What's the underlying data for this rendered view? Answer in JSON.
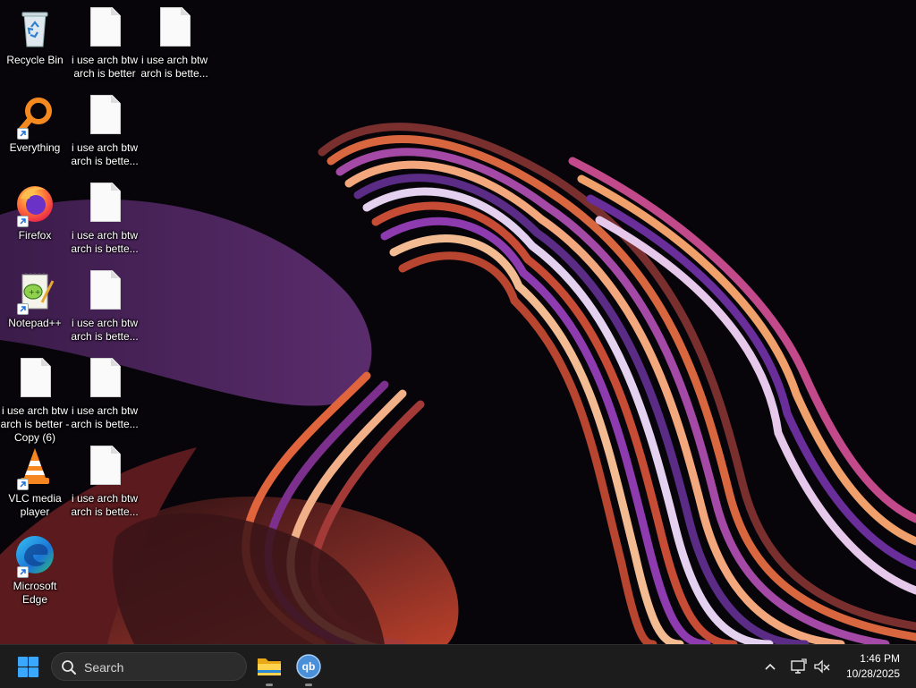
{
  "desktop": {
    "icons": [
      {
        "label": "Recycle Bin",
        "icon": "recycle-bin-icon",
        "shortcut": false
      },
      {
        "label": "i use arch btw arch is better",
        "icon": "text-document-icon",
        "shortcut": false
      },
      {
        "label": "i use arch btw arch is bette...",
        "icon": "text-document-icon",
        "shortcut": false
      },
      {
        "label": "Everything",
        "icon": "everything-search-icon",
        "shortcut": true
      },
      {
        "label": "i use arch btw arch is bette...",
        "icon": "text-document-icon",
        "shortcut": false
      },
      {
        "label": "Firefox",
        "icon": "firefox-icon",
        "shortcut": true
      },
      {
        "label": "i use arch btw arch is bette...",
        "icon": "text-document-icon",
        "shortcut": false
      },
      {
        "label": "Notepad++",
        "icon": "notepad-plus-plus-icon",
        "shortcut": true
      },
      {
        "label": "i use arch btw arch is bette...",
        "icon": "text-document-icon",
        "shortcut": false
      },
      {
        "label": "i use arch btw arch is better - Copy (6)",
        "icon": "text-document-icon",
        "shortcut": false
      },
      {
        "label": "i use arch btw arch is bette...",
        "icon": "text-document-icon",
        "shortcut": false
      },
      {
        "label": "VLC media player",
        "icon": "vlc-icon",
        "shortcut": true
      },
      {
        "label": "i use arch btw arch is bette...",
        "icon": "text-document-icon",
        "shortcut": false
      },
      {
        "label": "Microsoft Edge",
        "icon": "edge-icon",
        "shortcut": true
      }
    ]
  },
  "taskbar": {
    "start_icon": "windows-start-icon",
    "search_placeholder": "Search",
    "pinned_apps": [
      {
        "name": "File Explorer",
        "icon": "file-explorer-icon"
      },
      {
        "name": "qBittorrent",
        "icon": "qbittorrent-icon",
        "glyph": "qb"
      }
    ],
    "tray_icons": [
      "chevron-up-icon",
      "network-icon",
      "volume-muted-icon"
    ],
    "time": "1:46 PM",
    "date": "10/28/2025"
  },
  "colors": {
    "accent": "#3aa8ff",
    "taskbar_bg": "#1c1c1c"
  }
}
